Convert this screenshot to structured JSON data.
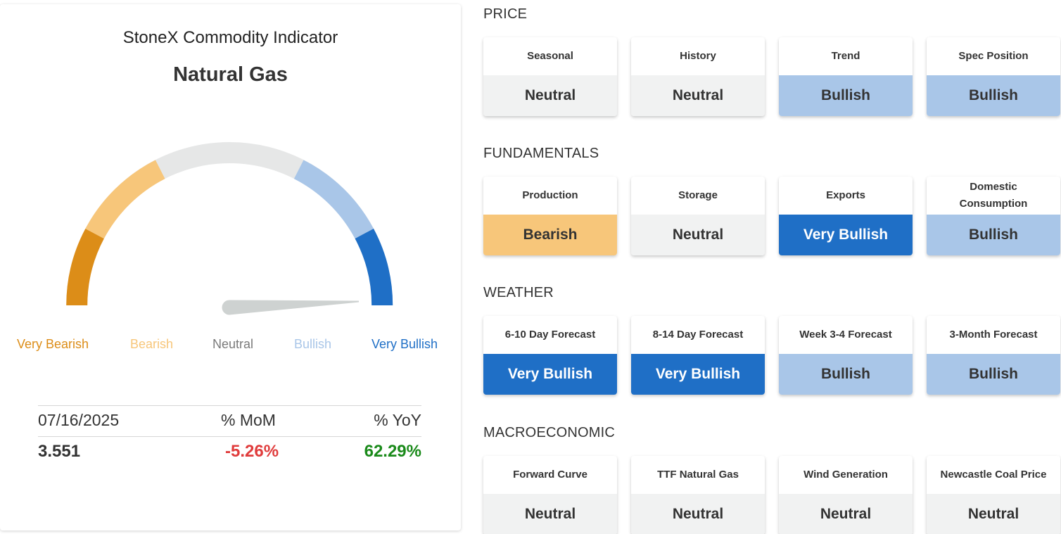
{
  "indicator": {
    "subtitle": "StoneX Commodity Indicator",
    "commodity": "Natural Gas",
    "reading": "Very Bullish",
    "scale": [
      {
        "label": "Very Bearish",
        "color": "#dc8d18"
      },
      {
        "label": "Bearish",
        "color": "#f7c67a"
      },
      {
        "label": "Neutral",
        "color": "#7a7a7a"
      },
      {
        "label": "Bullish",
        "color": "#a9c6e8"
      },
      {
        "label": "Very Bullish",
        "color": "#1f6fc6"
      }
    ],
    "track_color": "#e6e7e7",
    "needle_color": "#ced2d1"
  },
  "stats": {
    "date": "07/16/2025",
    "mom_label": "% MoM",
    "yoy_label": "% YoY",
    "price": "3.551",
    "mom_value": "-5.26%",
    "yoy_value": "62.29%",
    "negative_color": "#e03c3c",
    "positive_color": "#1a8a1a"
  },
  "sections": [
    {
      "title": "PRICE",
      "cards": [
        {
          "label": "Seasonal",
          "value": "Neutral"
        },
        {
          "label": "History",
          "value": "Neutral"
        },
        {
          "label": "Trend",
          "value": "Bullish"
        },
        {
          "label": "Spec Position",
          "value": "Bullish"
        }
      ]
    },
    {
      "title": "FUNDAMENTALS",
      "cards": [
        {
          "label": "Production",
          "value": "Bearish"
        },
        {
          "label": "Storage",
          "value": "Neutral"
        },
        {
          "label": "Exports",
          "value": "Very Bullish"
        },
        {
          "label": "Domestic Consumption",
          "value": "Bullish"
        }
      ]
    },
    {
      "title": "WEATHER",
      "cards": [
        {
          "label": "6-10 Day Forecast",
          "value": "Very Bullish"
        },
        {
          "label": "8-14 Day Forecast",
          "value": "Very Bullish"
        },
        {
          "label": "Week 3-4 Forecast",
          "value": "Bullish"
        },
        {
          "label": "3-Month Forecast",
          "value": "Bullish"
        }
      ]
    },
    {
      "title": "MACROECONOMIC",
      "cards": [
        {
          "label": "Forward Curve",
          "value": "Neutral"
        },
        {
          "label": "TTF Natural Gas",
          "value": "Neutral"
        },
        {
          "label": "Wind Generation",
          "value": "Neutral"
        },
        {
          "label": "Newcastle Coal Price",
          "value": "Neutral"
        }
      ]
    }
  ]
}
